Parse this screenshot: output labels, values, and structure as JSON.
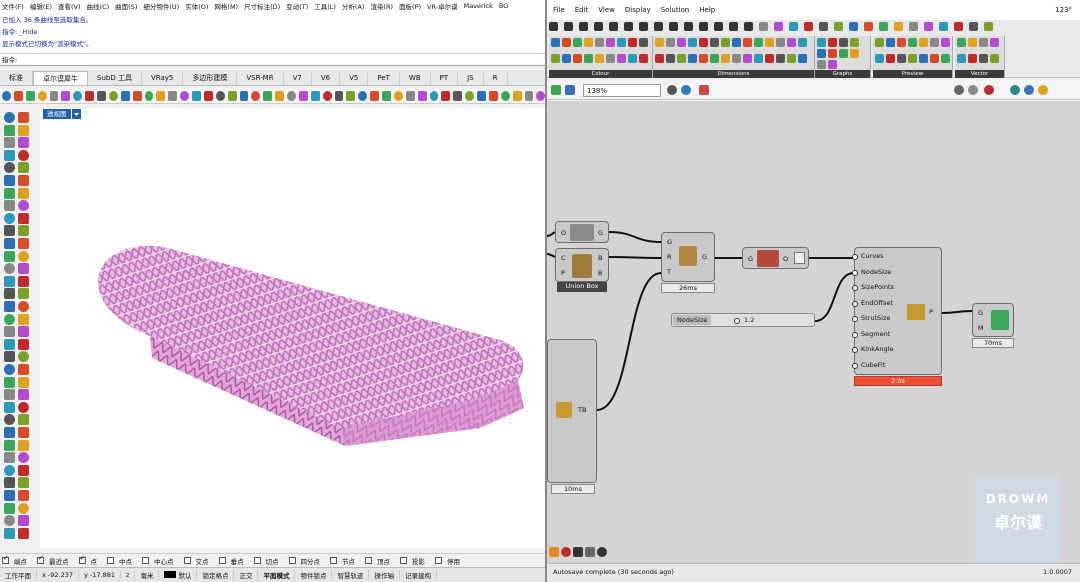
{
  "rhino": {
    "menu": [
      "文件(F)",
      "编辑(E)",
      "查看(V)",
      "曲线(C)",
      "曲面(S)",
      "细分物件(U)",
      "实体(O)",
      "网格(M)",
      "尺寸标注(D)",
      "变动(T)",
      "工具(L)",
      "分析(A)",
      "渲染(R)",
      "面板(P)",
      "VR-卓尔谟",
      "Maverick",
      "BG"
    ],
    "history": [
      "已加入 36 条曲线至选取集合。",
      "指令: _Hide",
      "显示模式已切换为\"渲染模式\"。"
    ],
    "command_prompt": "指令:",
    "tabs": [
      "标准",
      "卓尔谟犀牛",
      "SubD 工具",
      "VRay5",
      "多边形建模",
      "VSR-MR",
      "V7",
      "V6",
      "V5",
      "PeT",
      "WB",
      "PT",
      "JS",
      "R"
    ],
    "active_tab_index": 1,
    "viewport_label": "透视图",
    "osnaps": [
      {
        "label": "端点",
        "on": true
      },
      {
        "label": "最近点",
        "on": true
      },
      {
        "label": "点",
        "on": true
      },
      {
        "label": "中点",
        "on": false
      },
      {
        "label": "中心点",
        "on": false
      },
      {
        "label": "交点",
        "on": false
      },
      {
        "label": "垂点",
        "on": false
      },
      {
        "label": "切点",
        "on": false
      },
      {
        "label": "四分点",
        "on": false
      },
      {
        "label": "节点",
        "on": false
      },
      {
        "label": "顶点",
        "on": false
      },
      {
        "label": "投影",
        "on": false
      },
      {
        "label": "停用",
        "on": false
      }
    ],
    "status": {
      "cplane": "工作平面",
      "x": "x -92.237",
      "y": "y -17.881",
      "z": "z",
      "unit": "毫米",
      "layer": "默认",
      "items": [
        "锁定格点",
        "正交",
        "平面模式",
        "物件锁点",
        "智慧轨迹",
        "操作轴",
        "记录建构"
      ]
    }
  },
  "gh": {
    "menu": [
      "File",
      "Edit",
      "View",
      "Display",
      "Solution",
      "Help"
    ],
    "version_tag": "123°",
    "ribbon_groups": [
      "Colour",
      "Dimensions",
      "Graphs",
      "Preview",
      "Vector"
    ],
    "zoom": "138%",
    "status_message": "Autosave complete (30 seconds ago)",
    "version": "1.0.0007",
    "watermark_line1": "DROWM",
    "watermark_line2": "卓尔谟",
    "components": {
      "c1": {
        "in": "O",
        "out": "G"
      },
      "union_box": {
        "in1": "C",
        "in2": "P",
        "out1": "B",
        "out2": "B",
        "label": "Union Box"
      },
      "c3": {
        "in1": "G",
        "in2": "R",
        "in3": "T",
        "out": "G",
        "timing": "26ms"
      },
      "c4": {
        "in": "G",
        "out": "O"
      },
      "main": {
        "inputs": [
          "Curves",
          "NodeSize",
          "SizePoints",
          "EndOffset",
          "StrutSize",
          "Segment",
          "KinkAngle",
          "CubeFit"
        ],
        "out": "P",
        "timing": "2.0s"
      },
      "mesh": {
        "in1": "G",
        "in2": "M",
        "timing": "70ms"
      },
      "big": {
        "out": "TB",
        "timing": "10ms"
      },
      "slider": {
        "name": "NodeSize",
        "value": "1.2"
      }
    }
  }
}
